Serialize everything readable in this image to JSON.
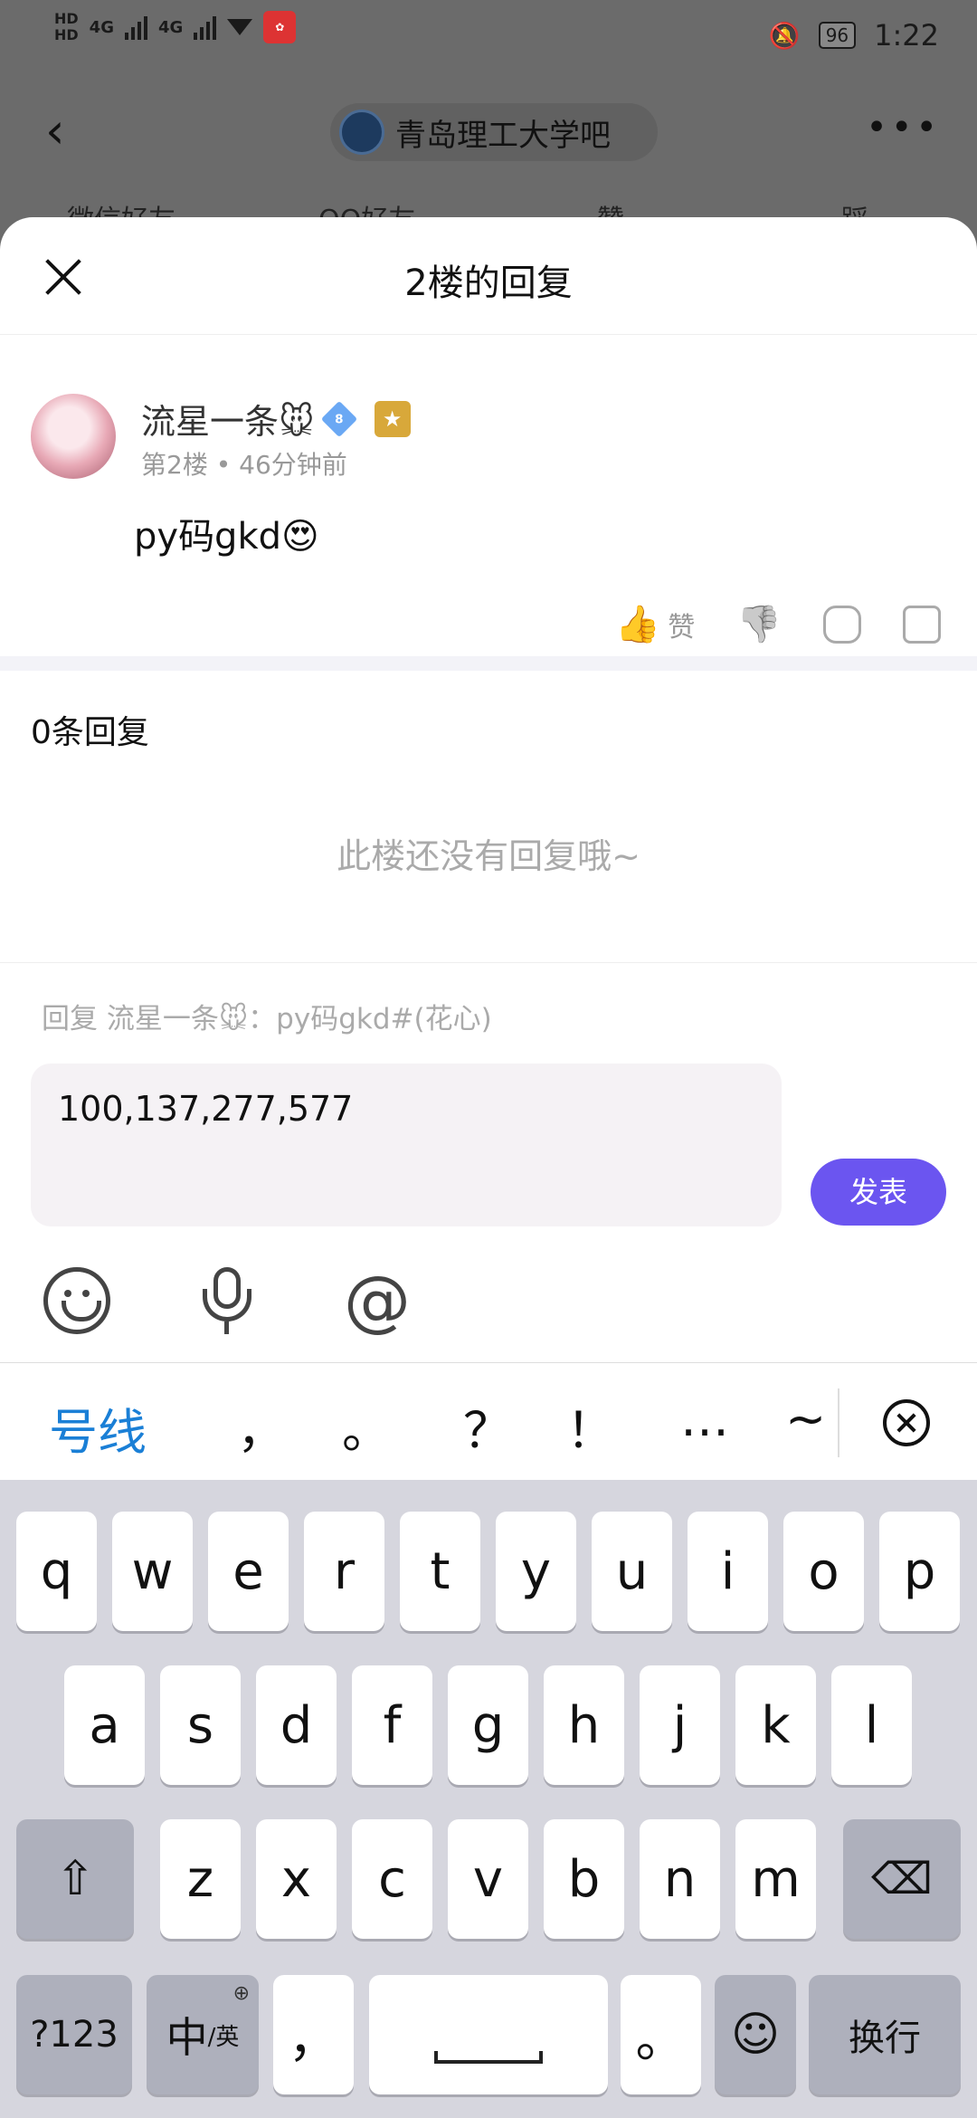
{
  "status_bar": {
    "left": [
      "HD",
      "HD",
      "4G",
      "4G"
    ],
    "battery": "96",
    "time": "1:22"
  },
  "forum": {
    "name": "青岛理工大学吧"
  },
  "share_row": [
    "微信好友",
    "QQ好友",
    "赞",
    "踩"
  ],
  "sheet": {
    "title": "2楼的回复",
    "post": {
      "author": "流星一条🐭",
      "level": "8",
      "floor": "第2楼",
      "time": "46分钟前",
      "content": "py码gkd😍",
      "like_label": "赞"
    },
    "reply_count": "0条回复",
    "empty_text": "此楼还没有回复哦~",
    "reply_hint": "回复 流星一条🐭：py码gkd#(花心)",
    "input_value": "100,137,277,577",
    "send_label": "发表"
  },
  "tools": [
    "emoji-icon",
    "microphone-icon",
    "at-icon"
  ],
  "keyboard": {
    "candidates": [
      "号线",
      "，",
      "。",
      "？",
      "！",
      "…",
      "~"
    ],
    "row1": [
      "q",
      "w",
      "e",
      "r",
      "t",
      "y",
      "u",
      "i",
      "o",
      "p"
    ],
    "row2": [
      "a",
      "s",
      "d",
      "f",
      "g",
      "h",
      "j",
      "k",
      "l"
    ],
    "row3": [
      "z",
      "x",
      "c",
      "v",
      "b",
      "n",
      "m"
    ],
    "bottom": {
      "numbers": "?123",
      "lang_main": "中",
      "lang_sub": "/英",
      "comma": "，",
      "period": "。",
      "enter": "换行"
    }
  },
  "colors": {
    "accent": "#6b55f0",
    "candidate": "#1a7fd6"
  }
}
